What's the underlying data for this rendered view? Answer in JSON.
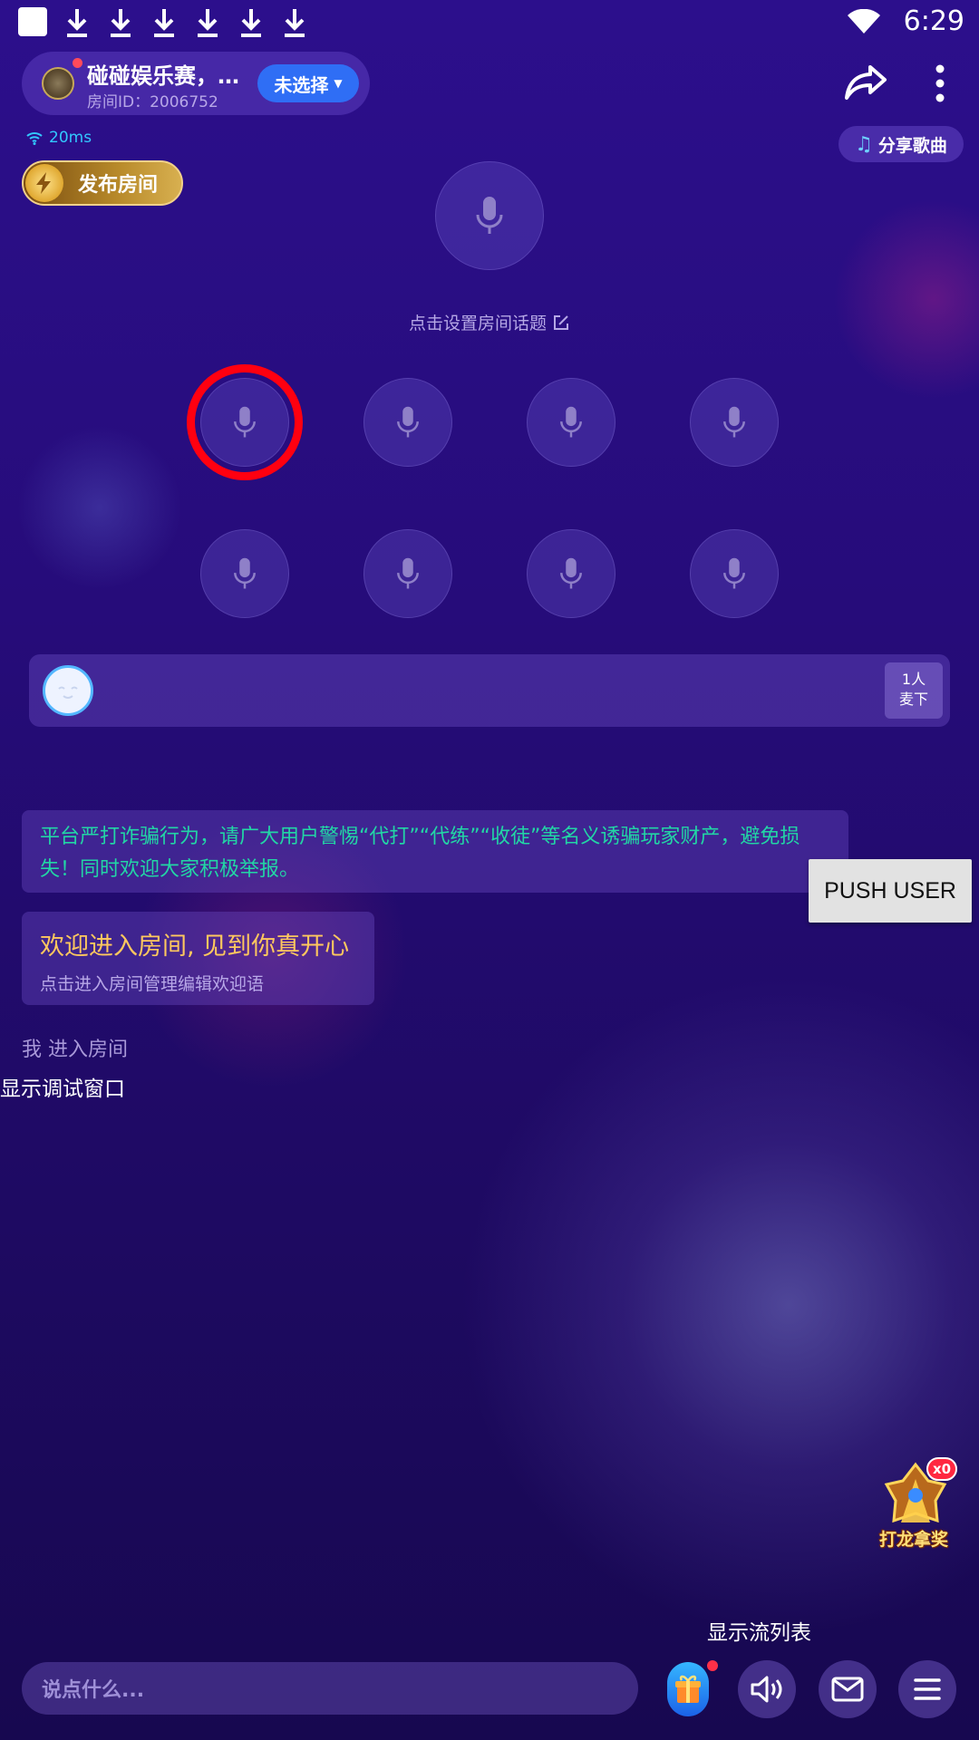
{
  "status_bar": {
    "time": "6:29"
  },
  "header": {
    "room_name": "碰碰娱乐赛，…",
    "room_id": "房间ID：2006752",
    "select_label": "未选择",
    "ping": "20ms",
    "share_song_label": "分享歌曲",
    "publish_label": "发布房间"
  },
  "seats": {
    "topic_hint": "点击设置房间话题"
  },
  "mic_queue": {
    "count_line1": "1人",
    "count_line2": "麦下"
  },
  "messages": {
    "notice": "平台严打诈骗行为，请广大用户警惕“代打”“代练”“收徒”等名义诱骗玩家财产，避免损失！同时欢迎大家积极举报。",
    "welcome_title": "欢迎进入房间, 见到你真开心",
    "welcome_sub": "点击进入房间管理编辑欢迎语",
    "entered": "我 进入房间"
  },
  "debug": {
    "push_user": "PUSH USER",
    "show_debug_window": "显示调试窗口",
    "show_stream_list": "显示流列表"
  },
  "activity": {
    "badge": "x0",
    "label": "打龙拿奖"
  },
  "bottom_bar": {
    "chat_placeholder": "说点什么..."
  },
  "colors": {
    "background": "#260c7a",
    "accent_blue": "#2f6ef5",
    "notice_green": "#22d6a5",
    "welcome_gold": "#ffc85e",
    "highlight_red": "#ff0010"
  }
}
